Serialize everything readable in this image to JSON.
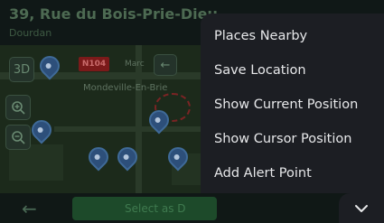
{
  "header": {
    "address": "39, Rue du Bois-Prie-Dieu",
    "subtitle": "Dourdan"
  },
  "map": {
    "road_sign": "N104",
    "road_label": "Marc",
    "town_label": "Mondeville-En-Brie",
    "buttons": [
      "3D",
      "zoom-in-icon",
      "zoom-out-icon"
    ]
  },
  "bottom": {
    "select_label": "Select as D"
  },
  "menu": {
    "items": [
      {
        "label": "Places Nearby"
      },
      {
        "label": "Save Location"
      },
      {
        "label": "Show Current Position"
      },
      {
        "label": "Show Cursor Position"
      },
      {
        "label": "Add Alert Point"
      }
    ]
  },
  "colors": {
    "menu_bg": "#1c1e23",
    "menu_text": "#e7e8ea",
    "map_dim": "#1c2a1b"
  }
}
